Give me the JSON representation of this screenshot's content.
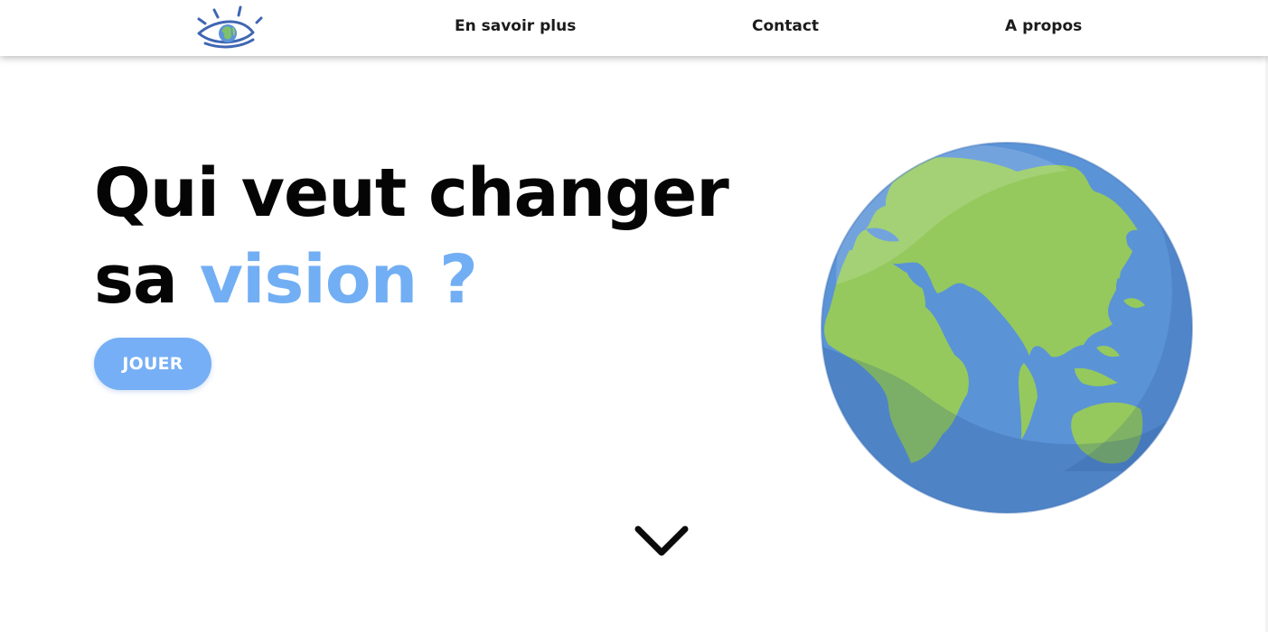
{
  "header": {
    "nav": [
      {
        "label": "En savoir plus"
      },
      {
        "label": "Contact"
      },
      {
        "label": "A propos"
      }
    ],
    "logo_icon": "eye-globe-icon"
  },
  "hero": {
    "title_line_1": "Qui veut changer",
    "title_line_2_prefix": "sa ",
    "title_line_2_accent": "vision ?",
    "cta_label": "JOUER",
    "scroll_icon": "chevron-down-icon"
  },
  "colors": {
    "accent": "#72aef3",
    "button": "#76aff5",
    "ocean": "#5b93d7",
    "land": "#95c95d",
    "logo_blue": "#3f66b3"
  }
}
